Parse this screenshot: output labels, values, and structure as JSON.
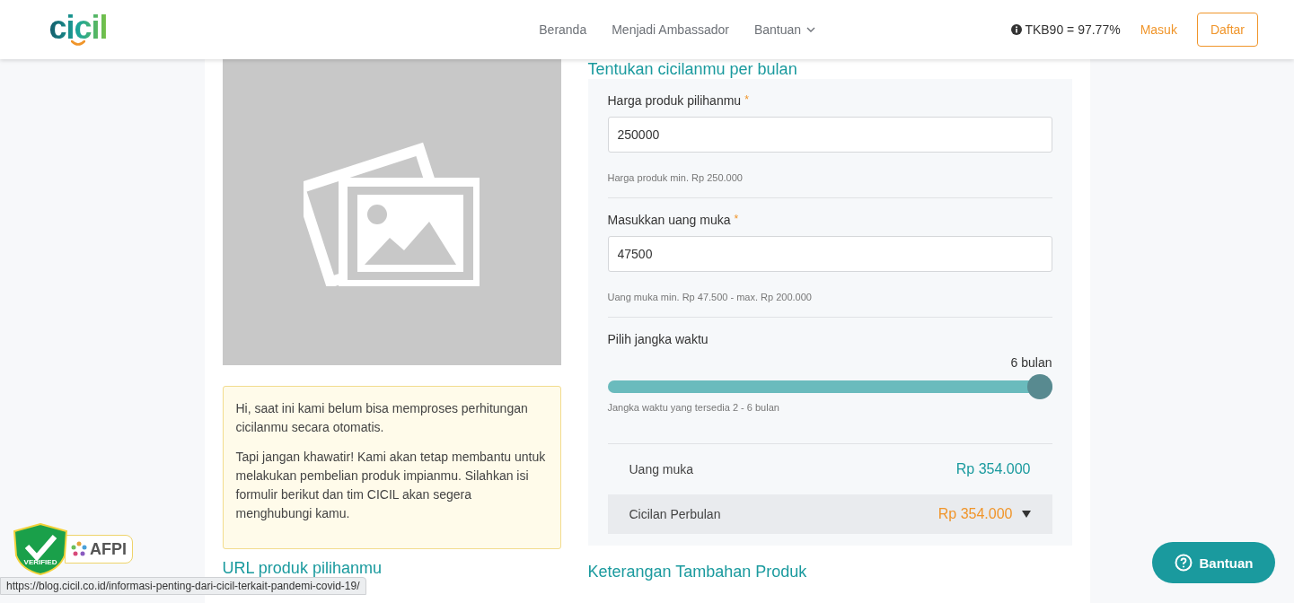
{
  "header": {
    "logo": "cicil",
    "nav": [
      {
        "label": "Beranda",
        "dropdown": false
      },
      {
        "label": "Menjadi Ambassador",
        "dropdown": false
      },
      {
        "label": "Bantuan",
        "dropdown": true
      }
    ],
    "tkb": "TKB90 = 97.77%",
    "login": "Masuk",
    "register": "Daftar"
  },
  "notice": {
    "paragraphs": [
      "Hi, saat ini kami belum bisa memproses perhitungan cicilanmu secara otomatis.",
      "Tapi jangan khawatir! Kami akan tetap membantu untuk melakukan pembelian produk impianmu. Silahkan isi formulir berikut dan tim CICIL akan segera menghubungi kamu."
    ]
  },
  "url_section": {
    "heading": "URL produk pilihanmu"
  },
  "calculator": {
    "heading": "Tentukan cicilanmu per bulan",
    "fields": [
      {
        "label": "Harga produk pilihanmu",
        "required_mark": "*",
        "value": "250000",
        "hint": "Harga produk min. Rp 250.000"
      },
      {
        "label": "Masukkan uang muka",
        "required_mark": "*",
        "value": "47500",
        "hint": "Uang muka min. Rp 47.500 - max. Rp 200.000"
      }
    ],
    "term": {
      "label": "Pilih jangka waktu",
      "reading": "6 bulan",
      "level": 1,
      "hint": "Jangka waktu yang tersedia 2 - 6 bulan"
    },
    "summary": [
      {
        "label": "Uang muka",
        "value": "Rp 354.000",
        "kind": "plain"
      },
      {
        "label": "Cicilan Perbulan",
        "value": "Rp 354.000",
        "kind": "expandable"
      }
    ]
  },
  "extra_section": {
    "heading": "Keterangan Tambahan Produk"
  },
  "badge": {
    "verified": "VERIFIED",
    "name": "AFPI"
  },
  "status_url": "https://blog.cicil.co.id/informasi-penting-dari-cicil-terkait-pandemi-covid-19/",
  "help_button": "Bantuan"
}
